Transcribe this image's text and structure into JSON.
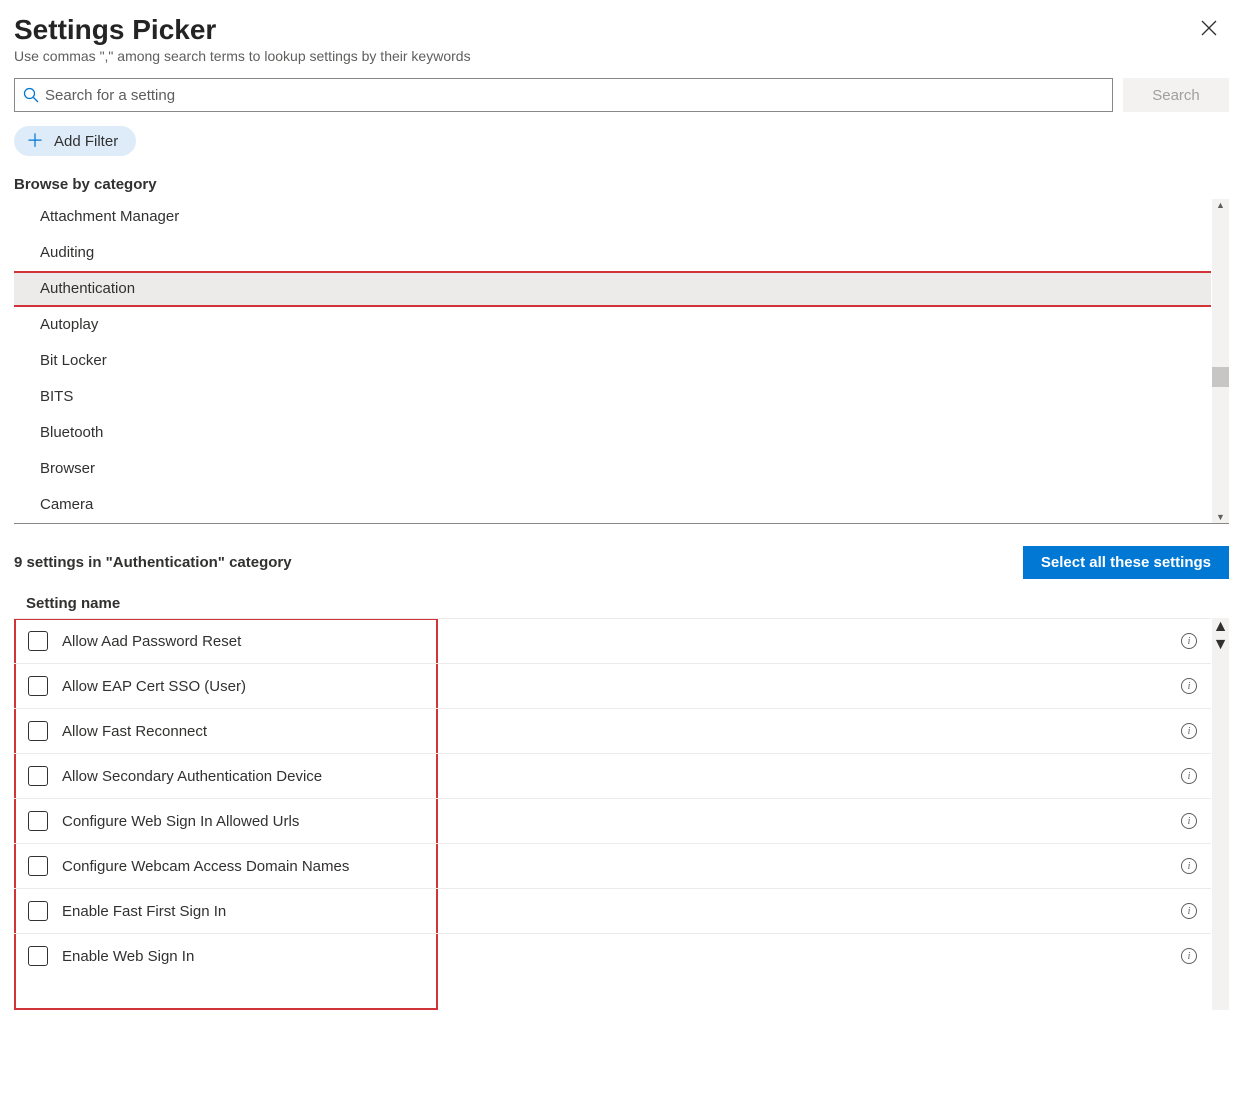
{
  "header": {
    "title": "Settings Picker",
    "subtitle": "Use commas \",\" among search terms to lookup settings by their keywords"
  },
  "search": {
    "placeholder": "Search for a setting",
    "button": "Search"
  },
  "filter": {
    "add_label": "Add Filter"
  },
  "browse": {
    "heading": "Browse by category",
    "categories": [
      "Attachment Manager",
      "Auditing",
      "Authentication",
      "Autoplay",
      "Bit Locker",
      "BITS",
      "Bluetooth",
      "Browser",
      "Camera"
    ],
    "selected_index": 2
  },
  "results": {
    "summary": "9 settings in \"Authentication\" category",
    "select_all": "Select all these settings",
    "column_header": "Setting name",
    "settings": [
      "Allow Aad Password Reset",
      "Allow EAP Cert SSO (User)",
      "Allow Fast Reconnect",
      "Allow Secondary Authentication Device",
      "Configure Web Sign In Allowed Urls",
      "Configure Webcam Access Domain Names",
      "Enable Fast First Sign In",
      "Enable Web Sign In"
    ]
  }
}
